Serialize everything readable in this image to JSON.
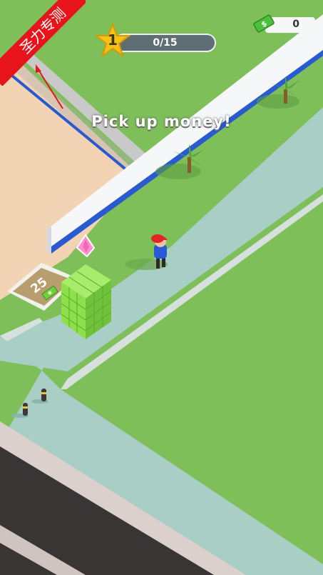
{
  "hud": {
    "level": "1",
    "progress_text": "0/15",
    "progress_fraction": 0,
    "cash_amount": "0",
    "cash_icon": "dollar-bill-icon",
    "level_icon": "star-icon"
  },
  "hint": {
    "text": "Pick up money!"
  },
  "ribbon": {
    "text": "圣力专测"
  },
  "unlock_pad": {
    "price": "25",
    "icon": "dollar-bill-icon"
  },
  "colors": {
    "grass": "#7fbf5a",
    "sand": "#f2d3b4",
    "path": "#a8cec6",
    "road": "#3a3535",
    "wall": "#f5f7f9",
    "wall_trim": "#2a5ad0",
    "money": "#8ee04a",
    "ribbon": "#e8141c"
  }
}
